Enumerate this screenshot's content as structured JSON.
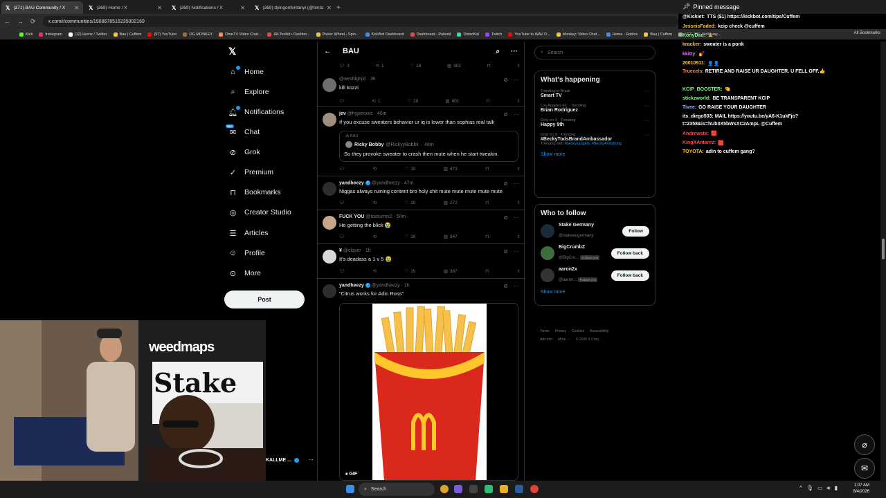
{
  "browser": {
    "tabs": [
      {
        "label": "(371) BAU Community / X",
        "active": true
      },
      {
        "label": "(369) Home / X",
        "active": false
      },
      {
        "label": "(369) Notifications / X",
        "active": false
      },
      {
        "label": "(369) dyingonfentanyl (@fenta",
        "active": false
      }
    ],
    "new_tab": "+",
    "url": "x.com/i/communities/1908678516235002169",
    "bookmarks": [
      "Kick",
      "Instagram",
      "(12) Home / Twitter",
      "Bau | Cuffem",
      "(57) YouTube",
      "OG MONKEY",
      "OmeTV Video Chat...",
      "IRLToolkit • Dashbo...",
      "Picker Wheel - Spin...",
      "KickBot Dashboard",
      "Dashboard - Pulsoid",
      "DistroKid",
      "Twitch",
      "YouTube to WAV D...",
      "Monkey: Video Chat...",
      "Home - Roblox",
      "Bau | Cuffem",
      "UFC 326: Holloway..."
    ],
    "all_bookmarks": "All Bookmarks"
  },
  "nav": {
    "items": [
      {
        "label": "Home",
        "icon": "home-icon"
      },
      {
        "label": "Explore",
        "icon": "search-icon"
      },
      {
        "label": "Notifications",
        "icon": "bell-icon"
      },
      {
        "label": "Chat",
        "icon": "chat-icon"
      },
      {
        "label": "Grok",
        "icon": "grok-icon"
      },
      {
        "label": "Premium",
        "icon": "premium-icon"
      },
      {
        "label": "Bookmarks",
        "icon": "bookmark-icon"
      },
      {
        "label": "Creator Studio",
        "icon": "creator-studio-icon"
      },
      {
        "label": "Articles",
        "icon": "articles-icon"
      },
      {
        "label": "Profile",
        "icon": "profile-icon"
      },
      {
        "label": "More",
        "icon": "more-icon"
      }
    ],
    "chat_badge": "99+",
    "post_label": "Post"
  },
  "webcam": {
    "sign_text": "weedmaps",
    "banner_text": "Stake",
    "account_label": "KALLME ..."
  },
  "community": {
    "title": "BAU",
    "top_actions": {
      "replies": "3",
      "reposts": "1",
      "likes": "16",
      "views": "902"
    },
    "tweets": [
      {
        "name": "",
        "handle": "@aesfdghjkl",
        "time": "3h",
        "text": "kill kozzi",
        "verified": false,
        "replies": "",
        "reposts": "1",
        "likes": "20",
        "views": "901"
      },
      {
        "name": "jev",
        "handle": "@hyperoxic",
        "time": "46m",
        "text": "If you excuse sweaters behavior ur iq is lower than sophias real talk",
        "verified": false,
        "replies": "",
        "reposts": "",
        "likes": "19",
        "views": "473",
        "quote": {
          "community": "BAU",
          "name": "Ricky Bobby",
          "handle": "@RickyyBobbii",
          "time": "48m",
          "text": "So they provoke sweater to crash then mute when he start tweakin."
        }
      },
      {
        "name": "yandheezy",
        "handle": "@yandheezy",
        "time": "47m",
        "text": "Niggas always ruining content bro holy shit mute mute mute mute mute",
        "verified": true,
        "replies": "",
        "reposts": "",
        "likes": "19",
        "views": "272"
      },
      {
        "name": "FUCK YOU",
        "handle": "@tooturntx2",
        "time": "50m",
        "text": "He getting the blick 😭",
        "verified": false,
        "replies": "",
        "reposts": "",
        "likes": "19",
        "views": "347"
      },
      {
        "name": "¥",
        "handle": "@clqxer",
        "time": "1h",
        "text": "It's deadass a 1 v 5 😭",
        "verified": false,
        "replies": "",
        "reposts": "",
        "likes": "19",
        "views": "387"
      },
      {
        "name": "yandheezy",
        "handle": "@yandheezy",
        "time": "1h",
        "text": "“Citrus works for Adin Ross”",
        "verified": true,
        "gif_label": "GIF"
      }
    ]
  },
  "right": {
    "search_placeholder": "Search",
    "happening_title": "What’s happening",
    "trends": [
      {
        "context": "Trending in Brazil",
        "name": "Smart TV",
        "with": "",
        "tags": []
      },
      {
        "context": "Los Angeles FC · Trending",
        "name": "Brian Rodriguez",
        "with": "",
        "tags": []
      },
      {
        "context": "Only on X · Trending",
        "name": "Happy 9th",
        "with": "",
        "tags": []
      },
      {
        "context": "Only on X · Trending",
        "name": "#BeckyTodsBrandAmbassador",
        "with": "Trending with",
        "tags": [
          "#beckysangels",
          "#BeckyArmstrong"
        ]
      }
    ],
    "show_more": "Show more",
    "who_to_follow_title": "Who to follow",
    "follow_suggestions": [
      {
        "name": "Stake Germany",
        "handle": "@stakeeugermany",
        "button": "Follow",
        "follows_you": "",
        "color": "#1a2c38"
      },
      {
        "name": "BigCrumbZ",
        "handle": "@BigCru...",
        "button": "Follow back",
        "follows_you": "Follows you",
        "color": "#3b6e3b"
      },
      {
        "name": "aaron2x",
        "handle": "@aaron...",
        "button": "Follow back",
        "follows_you": "Follows you",
        "color": "#333"
      }
    ],
    "show_more_follow": "Show more",
    "footer": [
      "Terms",
      "Privacy",
      "Cookies",
      "Accessibility",
      "Ads info",
      "More ···",
      "© 2026 X Corp."
    ]
  },
  "chat_overlay": {
    "pinned_label": "Pinned message",
    "lines": [
      {
        "user": "@Kickiet:",
        "msg": "TTS ($1) https://kickbot.com/tips/Cuffem",
        "color": "#ffffff"
      },
      {
        "user": "JesseisFaded:",
        "msg": "kcip check @cuffem",
        "color": "#f5c542"
      },
      {
        "user": "KonyDad:",
        "msg": "🙏",
        "color": "#8ef58e"
      },
      {
        "user": "kracker:",
        "msg": "sweater is a ponk",
        "color": "#f5c542"
      },
      {
        "user": "kkitty:",
        "msg": "💅",
        "color": "#e07de0"
      },
      {
        "user": "20010911:",
        "msg": "👤👤",
        "color": "#f5c542"
      },
      {
        "user": "Truecels:",
        "msg": "RETIRE AND RAISE UR DAUGHTER. U FELL OFF.👍",
        "color": "#f58e4a"
      },
      {
        "user": "KCIP_BOOSTER:",
        "msg": "🤏",
        "color": "#8ef58e"
      },
      {
        "user": "stickzworld:",
        "msg": "BE TRANSPARENT KCIP",
        "color": "#8ef58e"
      },
      {
        "user": "Tivee:",
        "msg": "GO RAISE YOUR DAUGHTER",
        "color": "#8eb8f5"
      },
      {
        "user": "its_diego503:",
        "msg": "MAIL https://youtu.be/yA6-K1ukFjo?t=2358&is=hUb0X5bWsXC2AmpL @Cuffem",
        "color": "#ffffff"
      },
      {
        "user": "Andrewstx:",
        "msg": "🟥",
        "color": "#f54a4a"
      },
      {
        "user": "KingXAntarez:",
        "msg": "🟥",
        "color": "#f54a4a"
      },
      {
        "user": "TOYOTA:",
        "msg": "adin to cuffem gang?",
        "color": "#f5c542"
      }
    ]
  },
  "taskbar": {
    "search_label": "Search",
    "time": "1:07 AM",
    "date": "8/4/2026"
  },
  "colors": {
    "accent": "#1d9bf0",
    "border": "#2f3336",
    "muted": "#71767b",
    "mcdonalds_red": "#da291c",
    "mcdonalds_yellow": "#ffc72c"
  }
}
